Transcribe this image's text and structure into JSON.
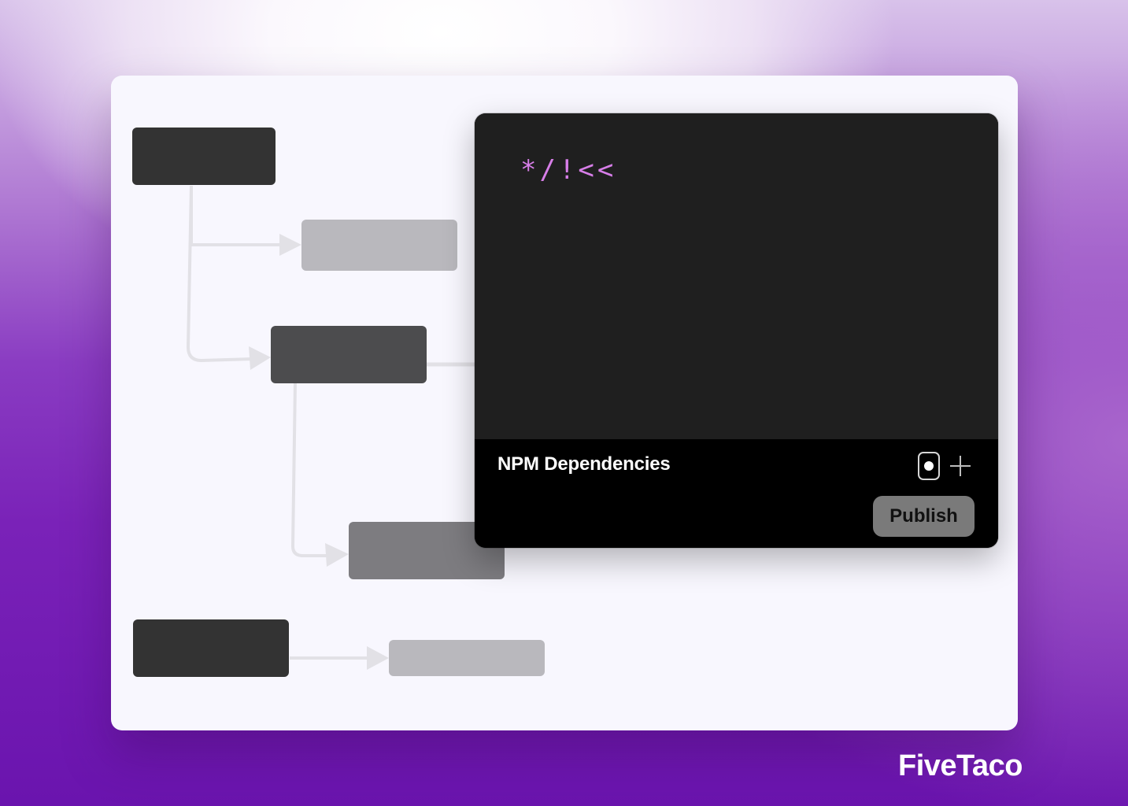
{
  "canvas": {
    "colors": {
      "card_background": "#f8f7fe",
      "connector": "#e2e1e6",
      "node_dark": "#333333",
      "node_mid": "#4c4c4e",
      "node_gray": "#7d7c80",
      "node_light": "#b9b8bd"
    },
    "nodes": [
      {
        "id": "node-a",
        "shade": "dark"
      },
      {
        "id": "node-b",
        "shade": "light"
      },
      {
        "id": "node-c",
        "shade": "mid"
      },
      {
        "id": "node-d",
        "shade": "gray"
      },
      {
        "id": "node-e",
        "shade": "dark"
      },
      {
        "id": "node-f",
        "shade": "light"
      }
    ],
    "edges": [
      {
        "from": "node-a",
        "to": "node-b"
      },
      {
        "from": "node-a",
        "to": "node-c"
      },
      {
        "from": "node-c",
        "to": "node-d"
      },
      {
        "from": "node-c",
        "to": "panel"
      },
      {
        "from": "node-e",
        "to": "node-f"
      }
    ]
  },
  "panel": {
    "code_snippet": "*/!<<",
    "code_color": "#d77ee8",
    "title": "NPM Dependencies",
    "icons": [
      "toggle-icon",
      "plus-icon"
    ],
    "publish_label": "Publish",
    "publish_color": "#7a7a7a"
  },
  "brand": {
    "name": "FiveTaco"
  }
}
